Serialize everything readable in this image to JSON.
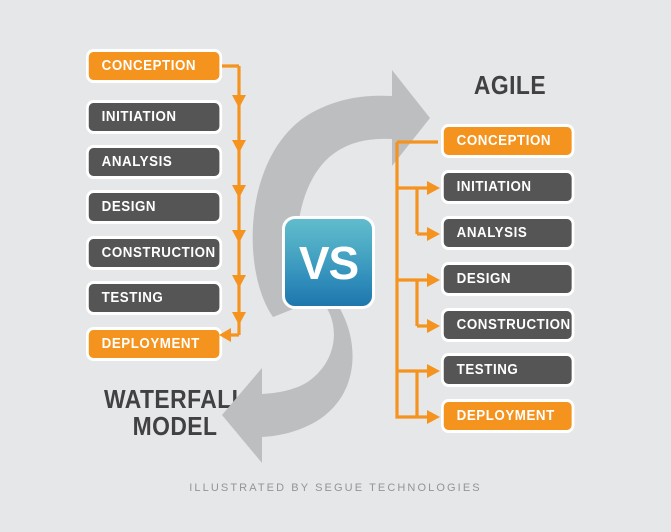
{
  "meta": {
    "background_color": "#e6e7e8",
    "orange": "#f5931f",
    "gray_box": "#555556",
    "title_color": "#414042",
    "credit_color": "#929497",
    "gray_arrow": "#bcbec0",
    "vs_gradient_top": "#60bccd",
    "vs_gradient_bottom": "#1f77ac"
  },
  "center": {
    "vs_label": "VS"
  },
  "waterfall": {
    "title": "WATERFALL\nMODEL",
    "title_line1": "WATERFALL",
    "title_line2": "MODEL",
    "phases": [
      {
        "label": "CONCEPTION",
        "style": "orange"
      },
      {
        "label": "INITIATION",
        "style": "gray"
      },
      {
        "label": "ANALYSIS",
        "style": "gray"
      },
      {
        "label": "DESIGN",
        "style": "gray"
      },
      {
        "label": "CONSTRUCTION",
        "style": "gray"
      },
      {
        "label": "TESTING",
        "style": "gray"
      },
      {
        "label": "DEPLOYMENT",
        "style": "orange"
      }
    ]
  },
  "agile": {
    "title": "AGILE",
    "phases": [
      {
        "label": "CONCEPTION",
        "style": "orange"
      },
      {
        "label": "INITIATION",
        "style": "gray"
      },
      {
        "label": "ANALYSIS",
        "style": "gray"
      },
      {
        "label": "DESIGN",
        "style": "gray"
      },
      {
        "label": "CONSTRUCTION",
        "style": "gray"
      },
      {
        "label": "TESTING",
        "style": "gray"
      },
      {
        "label": "DEPLOYMENT",
        "style": "orange"
      }
    ]
  },
  "footer": {
    "credit": "ILLUSTRATED BY SEGUE TECHNOLOGIES"
  }
}
